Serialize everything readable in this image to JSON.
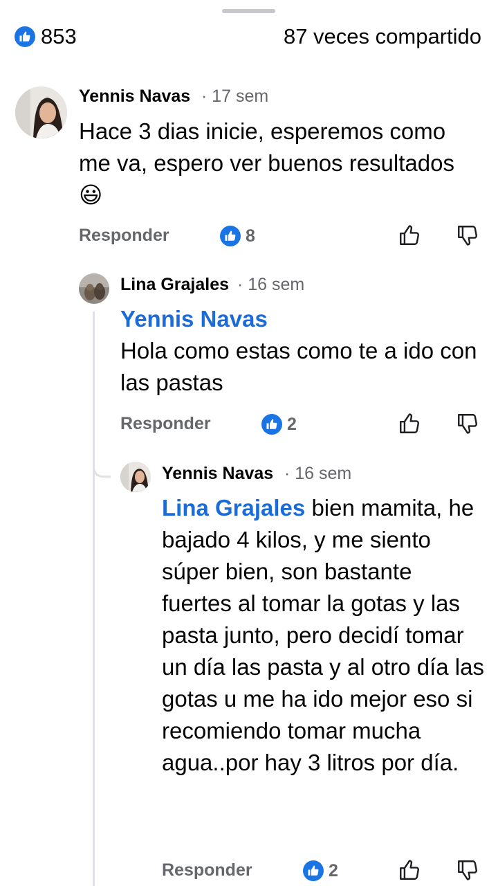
{
  "post_stats": {
    "reactions_count": "853",
    "shares_label": "87 veces compartido",
    "reaction_icon": "like-icon",
    "accent_color": "#1b74e4"
  },
  "comments": [
    {
      "author": "Yennis Navas",
      "time": "· 17 sem",
      "mention": "",
      "text": "Hace 3 dias inicie, esperemos como me va, espero ver buenos resultados",
      "emoji": "😃",
      "reply_label": "Responder",
      "like_count": "8"
    },
    {
      "author": "Lina Grajales",
      "time": "· 16 sem",
      "mention": "Yennis Navas",
      "text": "Hola como estas como te a ido con las pastas",
      "reply_label": "Responder",
      "like_count": "2"
    },
    {
      "author": "Yennis Navas",
      "time": "· 16 sem",
      "mention": "Lina Grajales",
      "text": "bien mamita, he bajado 4 kilos, y me siento súper bien, son bastante fuertes al tomar la gotas y las pasta junto, pero decidí tomar un día las pasta y al otro día las gotas u me ha ido mejor eso si recomiendo tomar mucha agua..por hay 3 litros por día.",
      "reply_label": "Responder",
      "like_count": "2"
    }
  ]
}
